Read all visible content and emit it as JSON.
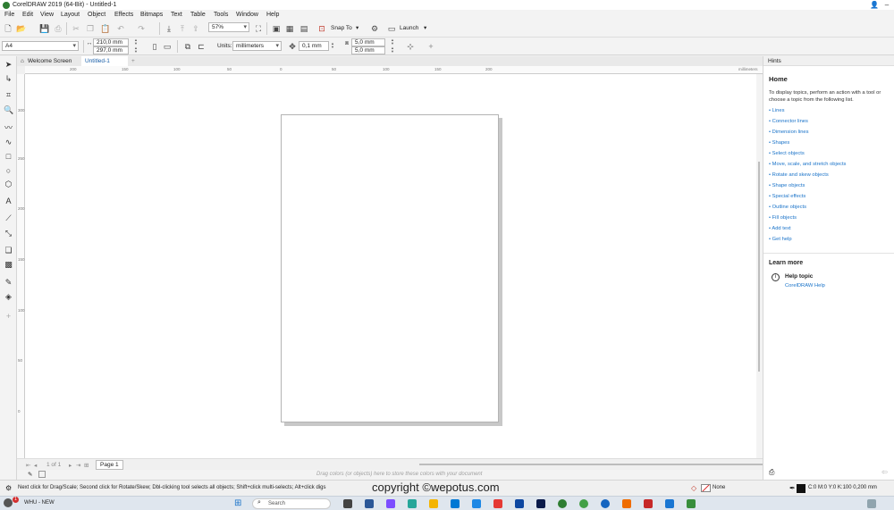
{
  "window": {
    "title": "CorelDRAW 2019 (64-Bit) - Untitled-1"
  },
  "menu": [
    "File",
    "Edit",
    "View",
    "Layout",
    "Object",
    "Effects",
    "Bitmaps",
    "Text",
    "Table",
    "Tools",
    "Window",
    "Help"
  ],
  "toolbar": {
    "zoom_value": "57%",
    "snap_label": "Snap To",
    "launch_label": "Launch"
  },
  "property_bar": {
    "page_size": "A4",
    "width": "210,0 mm",
    "height": "297,0 mm",
    "units_label": "Units:",
    "units_value": "millimeters",
    "nudge": "0,1 mm",
    "dup_x": "5,0 mm",
    "dup_y": "5,0 mm"
  },
  "doc_tabs": {
    "welcome": "Welcome Screen",
    "current": "Untitled-1"
  },
  "ruler": {
    "h_ticks": [
      "200",
      "150",
      "100",
      "50",
      "0",
      "50",
      "100",
      "150",
      "200"
    ],
    "unit": "millimeters",
    "v_ticks": [
      "300",
      "250",
      "200",
      "150",
      "100",
      "50",
      "0"
    ]
  },
  "page_nav": {
    "counter": "1 of 1",
    "page_tab": "Page 1"
  },
  "palette_hint": "Drag colors (or objects) here to store these colors with your document",
  "hints": {
    "panel_title": "Hints",
    "heading": "Home",
    "intro": "To display topics, perform an action with a tool or choose a topic from the following list.",
    "links": [
      "Lines",
      "Connector lines",
      "Dimension lines",
      "Shapes",
      "Select objects",
      "Move, scale, and stretch objects",
      "Rotate and skew objects",
      "Shape objects",
      "Special effects",
      "Outline objects",
      "Fill objects",
      "Add text",
      "Get help"
    ],
    "learn_more": "Learn more",
    "help_topic": "Help topic",
    "help_link": "CorelDRAW Help"
  },
  "status": {
    "message": "Next click for Drag/Scale; Second click for Rotate/Skew; Dbl-clicking tool selects all objects; Shift+click multi-selects; Alt+click digs",
    "copyright": "copyright ©wepotus.com",
    "fill": "None",
    "outline": "C:0 M:0 Y:0 K:100  0,200 mm"
  },
  "taskbar": {
    "app_label": "WHU - NEW",
    "badge": "1",
    "search_placeholder": "Search"
  },
  "colors": {
    "accent": "#1a73c9",
    "page_shadow": "#c8c8c8"
  }
}
